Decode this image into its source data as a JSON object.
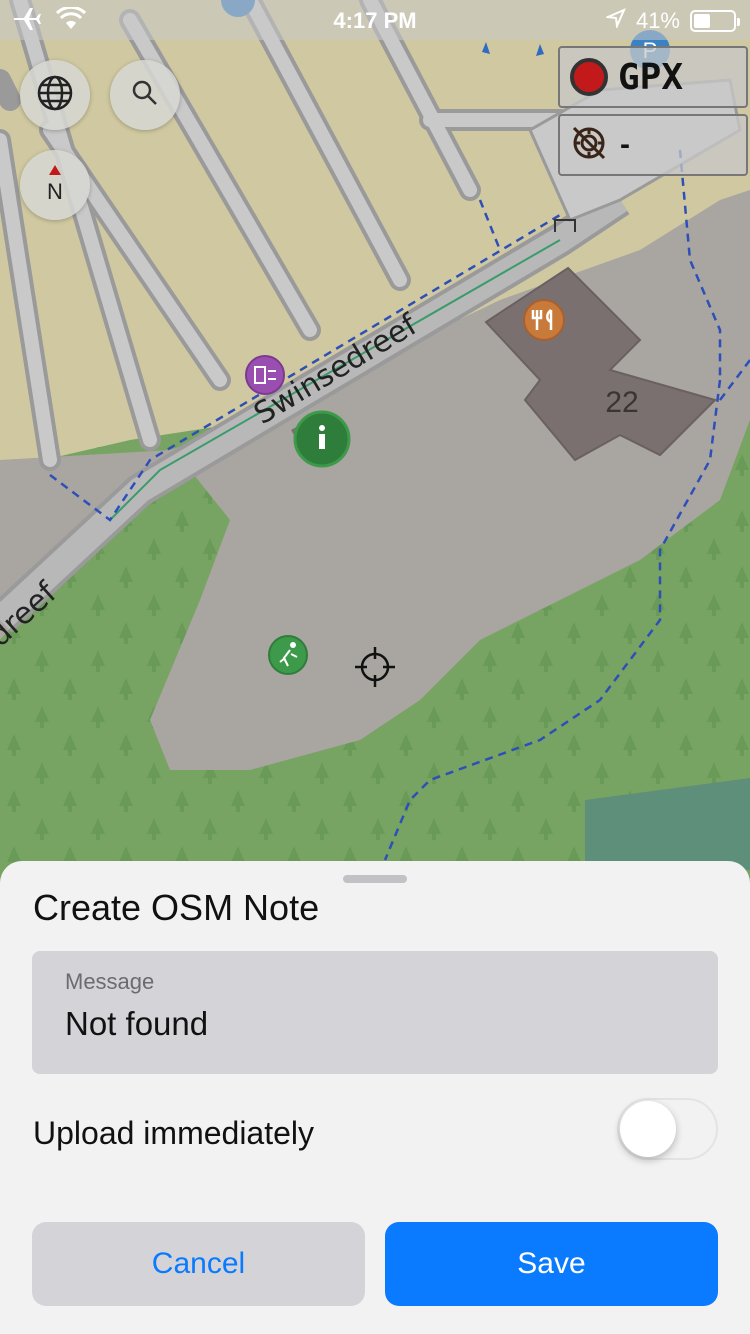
{
  "status_bar": {
    "time": "4:17 PM",
    "battery": "41%",
    "battery_level": 0.41,
    "icons": [
      "airplane-icon",
      "wifi-icon",
      "location-arrow-icon",
      "battery-icon"
    ]
  },
  "map": {
    "street_label_main": "Swinsedreef",
    "street_label_partial": "dreef",
    "building_number": "22",
    "icons": [
      "globe-icon",
      "search-icon",
      "compass-icon",
      "restaurant-icon",
      "info-icon",
      "exchange-icon",
      "sports-icon",
      "parking-icon",
      "crosshair-icon"
    ],
    "compass_label": "N",
    "gpx_label": "GPX",
    "track_value": "-",
    "colors": {
      "residential": "#cfc8a0",
      "plaza": "#a9a5a1",
      "forest": "#77a462",
      "water": "#5e8f7a",
      "building": "#7a7070",
      "road": "#9a9a9a",
      "footpath": "#2f4fb8"
    }
  },
  "sheet": {
    "title": "Create OSM Note",
    "message_label": "Message",
    "message_value": "Not found",
    "upload_label": "Upload immediately",
    "upload_on": false,
    "cancel_label": "Cancel",
    "save_label": "Save",
    "accent": "#0a7aff"
  }
}
